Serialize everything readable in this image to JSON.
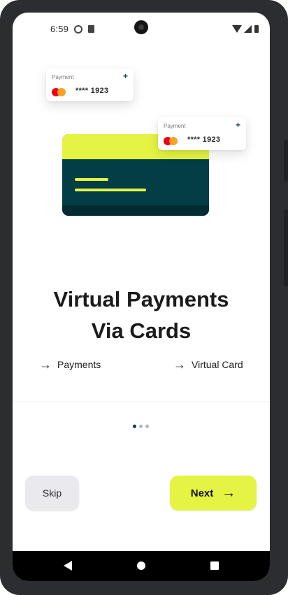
{
  "status_bar": {
    "time": "6:59"
  },
  "illustration": {
    "card_small_1": {
      "title": "Payment",
      "plus": "+",
      "number": "**** 1923"
    },
    "card_small_2": {
      "title": "Payment",
      "plus": "+",
      "number": "**** 1923"
    },
    "colors": {
      "accent_lime": "#e5f443",
      "card_teal": "#033e46",
      "mastercard_red": "#eb001b",
      "mastercard_orange": "#f79e1b"
    }
  },
  "heading": {
    "line1": "Virtual Payments",
    "line2": "Via Cards"
  },
  "features": [
    {
      "arrow": "→",
      "label": "Payments"
    },
    {
      "arrow": "→",
      "label": "Virtual Card"
    }
  ],
  "pagination": {
    "total": 3,
    "active": 1,
    "active_color": "#03414a",
    "inactive_color": "#b5b5b5"
  },
  "buttons": {
    "skip_label": "Skip",
    "next_label": "Next",
    "next_arrow": "→"
  },
  "nav_bar": {
    "back_icon": "back-triangle",
    "home_icon": "home-circle",
    "recents_icon": "recents-square"
  }
}
